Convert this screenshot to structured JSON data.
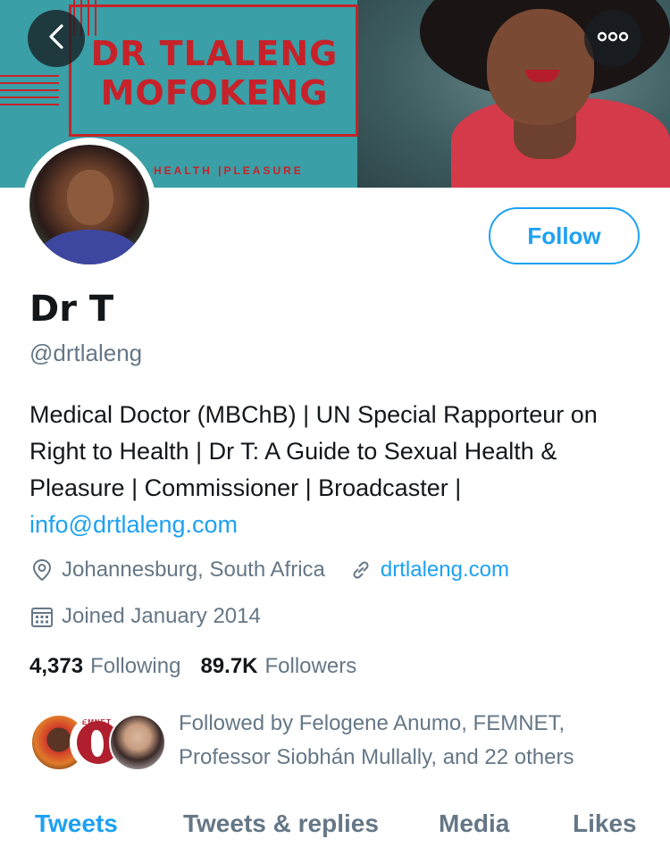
{
  "banner": {
    "title_line1": "DR TLALENG",
    "title_line2": "MOFOKENG",
    "tagline": "HEALTH |PLEASURE"
  },
  "nav": {
    "back_icon": "chevron-left-icon",
    "more_icon": "more-horizontal-icon"
  },
  "profile": {
    "follow_label": "Follow",
    "name": "Dr T",
    "handle": "@drtlaleng",
    "bio_text": "Medical Doctor (MBChB) | UN Special Rapporteur on Right to Health | Dr T: A Guide to Sexual Health & Pleasure | Commissioner | Broadcaster |",
    "bio_email": "info@drtlaleng.com",
    "location": "Johannesburg, South Africa",
    "website": "drtlaleng.com",
    "joined": "Joined January 2014"
  },
  "stats": {
    "following_count": "4,373",
    "following_label": "Following",
    "followers_count": "89.7K",
    "followers_label": "Followers"
  },
  "followed_by": {
    "text": "Followed by Felogene Anumo, FEMNET, Professor Siobhán Mullally, and 22 others",
    "badge_text": "FEMNET"
  },
  "tabs": [
    {
      "label": "Tweets",
      "active": true
    },
    {
      "label": "Tweets & replies",
      "active": false
    },
    {
      "label": "Media",
      "active": false
    },
    {
      "label": "Likes",
      "active": false
    }
  ],
  "colors": {
    "accent": "#1da1f2",
    "secondary_text": "#657786",
    "banner_red": "#c7222a",
    "banner_teal": "#3a9fa6"
  }
}
